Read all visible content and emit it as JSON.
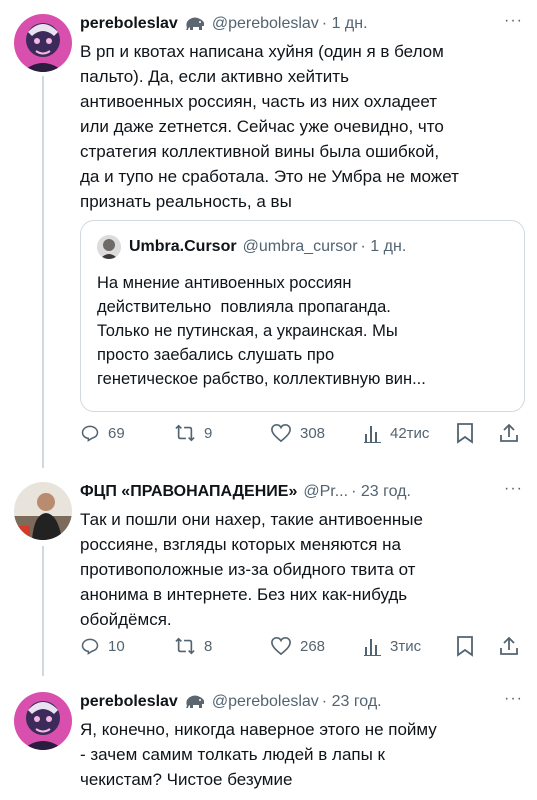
{
  "tweets": [
    {
      "name": "pereboleslav",
      "handle": "@pereboleslav",
      "time": "· 1 дн.",
      "text": "В рп и квотах написана хуйня (один я в белом\nпальто). Да, если активно хейтить\nантивоенных россиян, часть из них охладеет\nили даже zетнется. Сейчас уже очевидно, что\nстратегия коллективной вины была ошибкой,\nда и тупо не сработала. Это не Умбра не может\nпризнать реальность, а вы",
      "quote": {
        "name": "Umbra.Cursor",
        "handle": "@umbra_cursor",
        "time": "· 1 дн.",
        "text": "На мнение антивоенных россиян\nдействительно  повлияла пропаганда.\nТолько не путинская, а украинская. Мы\nпросто заебались слушать про\nгенетическое рабство, коллективную вин..."
      },
      "replies": "69",
      "retweets": "9",
      "likes": "308",
      "views": "42тис"
    },
    {
      "name": "ФЦП «ПРАВОНАПАДЕНИЕ»",
      "handle": "@Pr...",
      "time": "· 23 год.",
      "text": "Так и пошли они нахер, такие антивоенные\nроссияне, взгляды которых меняются на\nпротивоположные из-за обидного твита от\nанонима в интернете. Без них как-нибудь\nобойдёмся.",
      "replies": "10",
      "retweets": "8",
      "likes": "268",
      "views": "3тис"
    },
    {
      "name": "pereboleslav",
      "handle": "@pereboleslav",
      "time": "· 23 год.",
      "text": "Я, конечно, никогда наверное этого не пойму\n- зачем самим толкать людей в лапы к\nчекистам? Чистое безумие"
    }
  ],
  "more_label": "···",
  "icons": [
    "elephant-icon",
    "reply-icon",
    "retweet-icon",
    "like-icon",
    "views-icon",
    "bookmark-icon",
    "share-icon"
  ]
}
